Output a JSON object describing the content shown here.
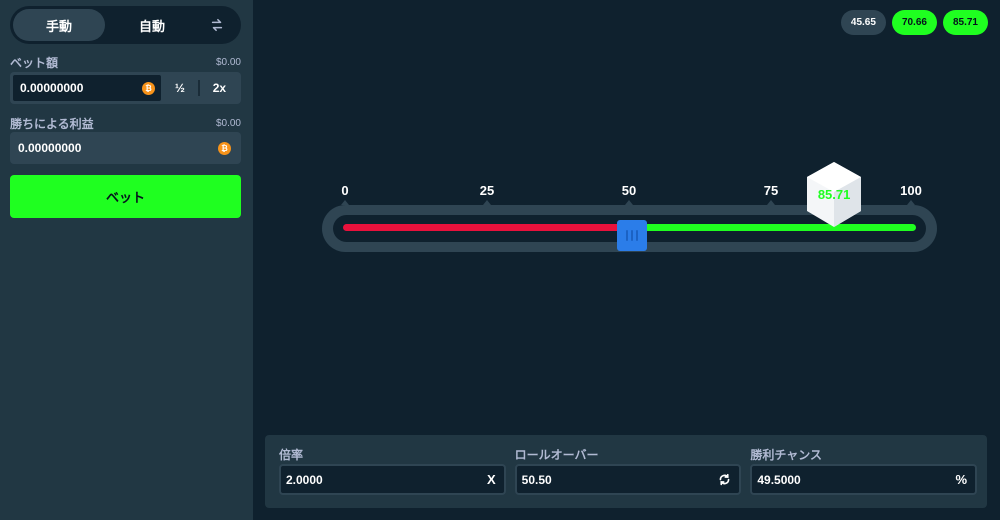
{
  "sidebar": {
    "tabs": {
      "manual": "手動",
      "auto": "自動",
      "swap_icon": "swap-arrows-icon"
    },
    "bet_amount": {
      "label": "ベット額",
      "usd": "$0.00",
      "value": "0.00000000",
      "currency_icon": "bitcoin-icon",
      "currency_glyph": "₿",
      "half_label": "½",
      "double_label": "2x"
    },
    "profit": {
      "label": "勝ちによる利益",
      "usd": "$0.00",
      "value": "0.00000000",
      "currency_icon": "bitcoin-icon",
      "currency_glyph": "₿"
    },
    "bet_button": "ベット"
  },
  "history": [
    {
      "value": "45.65",
      "status": "lose"
    },
    {
      "value": "70.66",
      "status": "win"
    },
    {
      "value": "85.71",
      "status": "win"
    }
  ],
  "slider": {
    "ticks": [
      "0",
      "25",
      "50",
      "75",
      "100"
    ],
    "min": 0,
    "max": 100,
    "roll_over": 50.5,
    "result": "85.71",
    "result_numeric": 85.71,
    "colors": {
      "lose": "#e9113c",
      "win": "#1fff20",
      "handle": "#2b7de9"
    }
  },
  "settings": {
    "multiplier": {
      "label": "倍率",
      "value": "2.0000",
      "suffix": "X"
    },
    "roll_over": {
      "label": "ロールオーバー",
      "value": "50.50",
      "icon": "refresh-icon"
    },
    "win_chance": {
      "label": "勝利チャンス",
      "value": "49.5000",
      "suffix": "%"
    }
  },
  "colors": {
    "background": "#0f212e",
    "panel": "#213743",
    "accent": "#1fff20",
    "input": "#2f4553"
  }
}
